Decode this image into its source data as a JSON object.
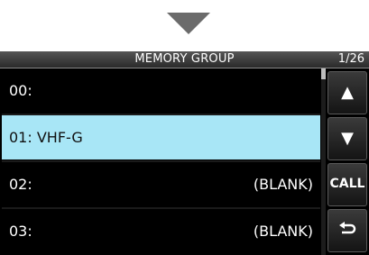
{
  "screen": {
    "title": "MEMORY GROUP",
    "page_indicator": "1/26"
  },
  "rows": [
    {
      "label": "00:",
      "value": ""
    },
    {
      "label": "01: VHF-G",
      "value": ""
    },
    {
      "label": "02:",
      "value": "(BLANK)"
    },
    {
      "label": "03:",
      "value": "(BLANK)"
    }
  ],
  "selected_row": 1,
  "buttons": {
    "up_icon": "up-arrow-icon",
    "down_icon": "down-arrow-icon",
    "call_label": "CALL",
    "back_icon": "return-arrow-icon"
  },
  "colors": {
    "highlight": "#a8e6f6",
    "background": "#000000",
    "text": "#ffffff",
    "pointer": "#6b6b6b"
  }
}
